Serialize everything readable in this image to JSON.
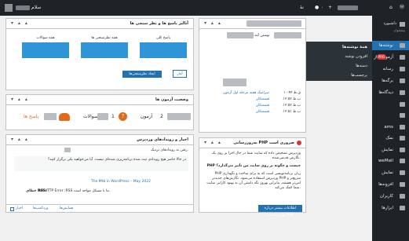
{
  "adminbar": {
    "greeting": "سلام",
    "comments_count": "۰",
    "new_label": "+",
    "site_menu": "نهٔ"
  },
  "sidebar": {
    "items": [
      {
        "label": "پیشخوان",
        "icon": "dashboard-icon"
      },
      {
        "label": "نوشته‌ها",
        "icon": "pin-icon"
      },
      {
        "label": "آزمون ساز",
        "icon": "quiz-icon",
        "badge": "PRO"
      },
      {
        "label": "رسانه",
        "icon": "media-icon"
      },
      {
        "label": "برگه‌ها",
        "icon": "page-icon"
      },
      {
        "label": "دیدگاه‌ها",
        "icon": "comment-icon"
      },
      {
        "label": "",
        "icon": "blank-icon"
      },
      {
        "label": "",
        "icon": "blank-icon"
      },
      {
        "label": "ams",
        "icon": "ams-icon"
      },
      {
        "label": "نمک",
        "icon": "salt-icon"
      },
      {
        "label": "نمایش",
        "icon": "appearance-icon"
      },
      {
        "label": "weMail",
        "icon": "email-icon"
      },
      {
        "label": "نمایش",
        "icon": "brush-icon"
      },
      {
        "label": "افزونه‌ها",
        "icon": "plugin-icon"
      },
      {
        "label": "کاربران",
        "icon": "users-icon"
      },
      {
        "label": "ابزارها",
        "icon": "tools-icon"
      }
    ],
    "current": "نوشته‌ها",
    "top_small": "داشبورد",
    "top_small2": "پیشخوان"
  },
  "flyout": {
    "items": [
      "همهٔ نوشته‌ها",
      "افزودن نوشته",
      "دسته‌ها",
      "برچسب‌ها"
    ]
  },
  "boxes": {
    "poll": {
      "title": "آنالیز پاسخ ها و نظر سنجی ها",
      "columns": [
        "پاسخ کلی",
        "همه نظرسنجی ها",
        "همه سوالات"
      ],
      "create_button": "ایجاد نظرسنجی‌ها",
      "stats_button": "آمار"
    },
    "quiz_status": {
      "title": "وضعیت آزمون ها",
      "quizzes": "آزمون",
      "questions": "سوالات",
      "answers": "پاسخ ها",
      "quizzes_count": "2",
      "questions_count": "1"
    },
    "events": {
      "title": "اخبار و رویدادهای وردپرس",
      "intro": "رفتن به رویدادهای نزدیک.",
      "line1": "در حالا حاضر هیچ رویدادی ثبت شده برنامه‌ریزی شده‌ای نیست. آیا می‌خواهید یکی برگزار کنید؟",
      "news1": "The Mtb in WordPress – May 2022",
      "rss_error_label": "خطای RSS:",
      "rss_error": "WP HTTP Error :RSS ما با مشکل مواجه است.",
      "footer": [
        "همایش‌ها",
        "وردکمپ‌ها",
        "اخبار"
      ]
    },
    "activity": {
      "title": "فعالیت",
      "recent": "نوشتن آمد",
      "rows": [
        {
          "date": "۱۰:۴۴ ق.ظ",
          "text": "سرامیک هفته مرحله اول آزمون"
        },
        {
          "date": "۱۲:۵۲ ب.ظ",
          "text": "قسمتکان"
        },
        {
          "date": "۱۲:۵۲ ب.ظ",
          "text": "قسمتکان"
        },
        {
          "date": "۱۲:۵۱ ب.ظ",
          "text": "قسمتکان"
        }
      ]
    },
    "php": {
      "title": "به‌روزرسانی PHP ضروری است",
      "p1": "وردپرس تشخیص داده که سایت شما در حال اجرا بر روی یک نگارش قدیمی‌شده.",
      "q": "PHP چیست و چگونه بر روی سایت من تأثیر می‌گذارد؟",
      "p2": "PHP زبان برنامه‌نویسی است که به برای ساخت و نگهداری وردپرس استفاده می‌شود. نگارش‌های جدیدتر PHP سریع‌تر و امن‌تر هستند، بنابراین بهروز نگه داشتن آن به بهبود کارایی سایت شما کمک می‌کند.",
      "button": "اطلاعات بیشتر درباره بهروزرسانی PHP"
    }
  },
  "colors": {
    "adminbar": "#1d2327",
    "accent": "#2271b1",
    "tile": "#2f95d7",
    "error": "#d63638"
  }
}
